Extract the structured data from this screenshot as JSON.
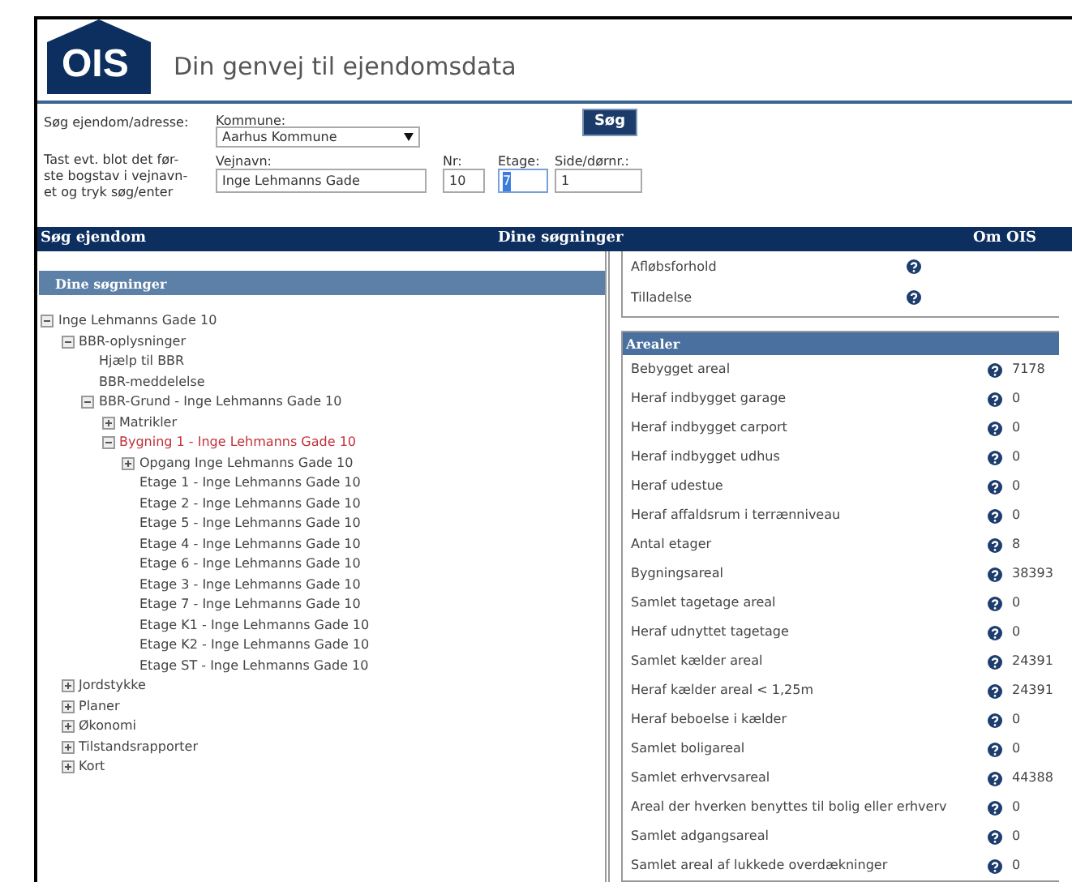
{
  "header": {
    "logo": "OIS",
    "tagline": "Din genvej til ejendomsdata"
  },
  "search_form": {
    "label": "Søg ejendom/adresse:",
    "hint_lines": [
      "Tast evt. blot det før-",
      "ste bogstav i vejnavn-",
      "et og tryk søg/enter"
    ],
    "kommune": {
      "label": "Kommune:",
      "value": "Aarhus Kommune"
    },
    "vejnavn": {
      "label": "Vejnavn:",
      "value": "Inge Lehmanns Gade"
    },
    "nr": {
      "label": "Nr:",
      "value": "10"
    },
    "etage": {
      "label": "Etage:",
      "value": "7",
      "text_selected": true
    },
    "side": {
      "label": "Side/dørnr.:",
      "value": "1"
    },
    "button": "Søg"
  },
  "nav": [
    "Søg ejendom",
    "Dine søgninger",
    "Om OIS"
  ],
  "left_panel": {
    "title": "Dine søgninger",
    "tree": [
      {
        "label": "Inge Lehmanns Gade 10",
        "expanded": true,
        "selected": false,
        "children": [
          {
            "label": "BBR-oplysninger",
            "expanded": true,
            "selected": false,
            "children": [
              {
                "label": "Hjælp til BBR",
                "selected": false
              },
              {
                "label": "BBR-meddelelse",
                "selected": false
              },
              {
                "label": "BBR-Grund - Inge Lehmanns Gade 10",
                "expanded": true,
                "selected": false,
                "children": [
                  {
                    "label": "Matrikler",
                    "expanded": false,
                    "selected": false
                  },
                  {
                    "label": "Bygning 1 - Inge Lehmanns Gade 10",
                    "expanded": true,
                    "selected": true,
                    "children": [
                      {
                        "label": "Opgang Inge Lehmanns Gade 10",
                        "expanded": false,
                        "selected": false
                      },
                      {
                        "label": "Etage 1 - Inge Lehmanns Gade 10",
                        "selected": false
                      },
                      {
                        "label": "Etage 2 - Inge Lehmanns Gade 10",
                        "selected": false
                      },
                      {
                        "label": "Etage 5 - Inge Lehmanns Gade 10",
                        "selected": false
                      },
                      {
                        "label": "Etage 4 - Inge Lehmanns Gade 10",
                        "selected": false
                      },
                      {
                        "label": "Etage 6 - Inge Lehmanns Gade 10",
                        "selected": false
                      },
                      {
                        "label": "Etage 3 - Inge Lehmanns Gade 10",
                        "selected": false
                      },
                      {
                        "label": "Etage 7 - Inge Lehmanns Gade 10",
                        "selected": false
                      },
                      {
                        "label": "Etage K1 - Inge Lehmanns Gade 10",
                        "selected": false
                      },
                      {
                        "label": "Etage K2 - Inge Lehmanns Gade 10",
                        "selected": false
                      },
                      {
                        "label": "Etage ST - Inge Lehmanns Gade 10",
                        "selected": false
                      }
                    ]
                  }
                ]
              }
            ]
          },
          {
            "label": "Jordstykke",
            "expanded": false,
            "selected": false
          },
          {
            "label": "Planer",
            "expanded": false,
            "selected": false
          },
          {
            "label": "Økonomi",
            "expanded": false,
            "selected": false
          },
          {
            "label": "Tilstandsrapporter",
            "expanded": false,
            "selected": false
          },
          {
            "label": "Kort",
            "expanded": false,
            "selected": false
          }
        ]
      }
    ]
  },
  "details_top": [
    {
      "label": "Afløbsforhold"
    },
    {
      "label": "Tilladelse"
    }
  ],
  "arealer": {
    "title": "Arealer",
    "rows": [
      {
        "label": "Bebygget areal",
        "value": "7178"
      },
      {
        "label": "Heraf indbygget garage",
        "value": "0"
      },
      {
        "label": "Heraf indbygget carport",
        "value": "0"
      },
      {
        "label": "Heraf indbygget udhus",
        "value": "0"
      },
      {
        "label": "Heraf udestue",
        "value": "0"
      },
      {
        "label": "Heraf affaldsrum i terrænniveau",
        "value": "0"
      },
      {
        "label": "Antal etager",
        "value": "8"
      },
      {
        "label": "Bygningsareal",
        "value": "38393"
      },
      {
        "label": "Samlet tagetage areal",
        "value": "0"
      },
      {
        "label": "Heraf udnyttet tagetage",
        "value": "0"
      },
      {
        "label": "Samlet kælder areal",
        "value": "24391"
      },
      {
        "label": "Heraf kælder areal < 1,25m",
        "value": "24391"
      },
      {
        "label": "Heraf beboelse i kælder",
        "value": "0"
      },
      {
        "label": "Samlet boligareal",
        "value": "0"
      },
      {
        "label": "Samlet erhvervsareal",
        "value": "44388"
      },
      {
        "label": "Areal der hverken benyttes til bolig eller erhverv",
        "value": "0"
      },
      {
        "label": "Samlet adgangsareal",
        "value": "0"
      },
      {
        "label": "Samlet areal af lukkede overdækninger",
        "value": "0"
      }
    ]
  }
}
